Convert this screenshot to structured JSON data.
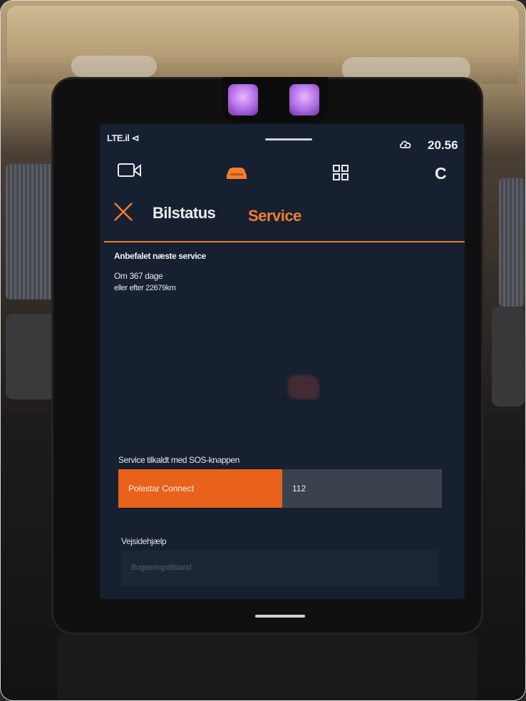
{
  "status_bar": {
    "signal": "LTE.il ⊲",
    "time": "20.56"
  },
  "nav": {
    "climate_label": "C"
  },
  "header": {
    "tab_bilstatus": "Bilstatus",
    "tab_service": "Service"
  },
  "recommended": {
    "title": "Anbefalet næste service",
    "days": "Om 367 dage",
    "distance": "eller efter 22679km"
  },
  "sos": {
    "label": "Service tilkaldt med SOS-knappen",
    "polestar_button": "Polestar Connect",
    "emergency_button": "112"
  },
  "roadside": {
    "label": "Vejsidehjælp",
    "towing": "Bugseringstilstand"
  },
  "colors": {
    "accent": "#f07a2a",
    "button_orange": "#e8621c",
    "screen_bg": "#162030"
  }
}
